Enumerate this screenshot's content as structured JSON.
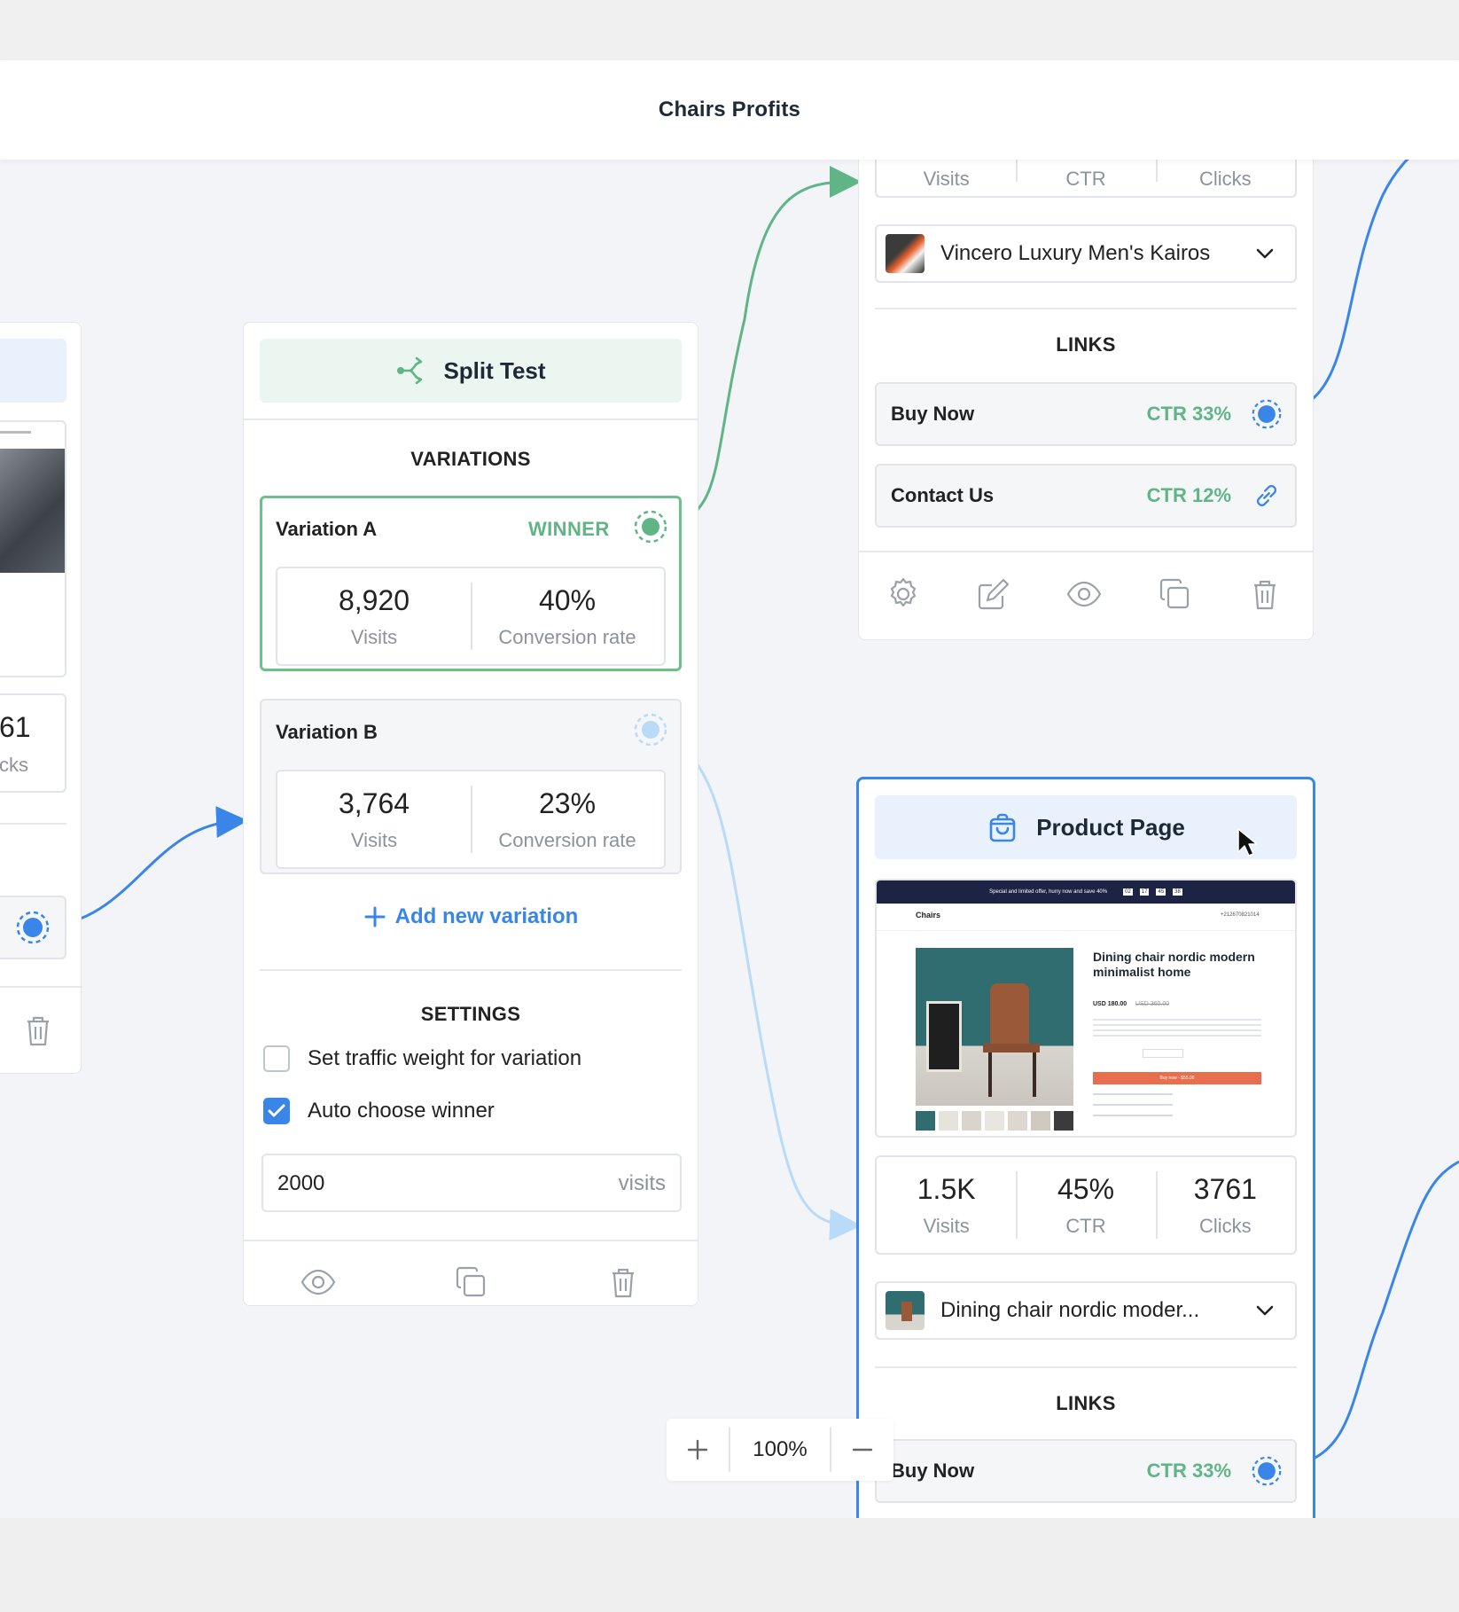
{
  "header": {
    "title": "Chairs Profits"
  },
  "left_card": {
    "stat_value": "61",
    "stat_label": "cks"
  },
  "split_test": {
    "title": "Split Test",
    "variations_title": "VARIATIONS",
    "variation_a": {
      "name": "Variation A",
      "badge": "WINNER",
      "visits": "8,920",
      "visits_label": "Visits",
      "rate": "40%",
      "rate_label": "Conversion rate"
    },
    "variation_b": {
      "name": "Variation B",
      "visits": "3,764",
      "visits_label": "Visits",
      "rate": "23%",
      "rate_label": "Conversion rate"
    },
    "add_variation": "Add new variation",
    "settings_title": "SETTINGS",
    "settings": {
      "traffic_weight": {
        "label": "Set traffic weight for variation",
        "checked": false
      },
      "auto_winner": {
        "label": "Auto choose winner",
        "checked": true
      }
    },
    "visits_input": {
      "value": "2000",
      "suffix": "visits"
    }
  },
  "top_card": {
    "stat_labels": [
      "Visits",
      "CTR",
      "Clicks"
    ],
    "product_select": "Vincero Luxury Men's Kairos",
    "links_title": "LINKS",
    "links": [
      {
        "label": "Buy Now",
        "ctr": "CTR 33%"
      },
      {
        "label": "Contact Us",
        "ctr": "CTR 12%"
      }
    ]
  },
  "product_card": {
    "title": "Product Page",
    "preview": {
      "banner": "Special and limited offer, hurry now and save 40%",
      "countdown": [
        "02",
        "17",
        "45",
        "38"
      ],
      "brand": "Chairs",
      "phone": "+212670821014",
      "product_title": "Dining chair nordic modern minimalist home",
      "price": "USD 180.00",
      "old_price": "USD 360.00",
      "button": "Buy now - $55.00"
    },
    "stats": [
      {
        "value": "1.5K",
        "label": "Visits"
      },
      {
        "value": "45%",
        "label": "CTR"
      },
      {
        "value": "3761",
        "label": "Clicks"
      }
    ],
    "product_select": "Dining chair nordic moder...",
    "links_title": "LINKS",
    "links": [
      {
        "label": "Buy Now",
        "ctr": "CTR 33%"
      }
    ]
  },
  "zoom": {
    "level": "100%"
  },
  "colors": {
    "accent_blue": "#3a86e8",
    "success_green": "#5fb585",
    "light_blue": "#b9dbf7"
  }
}
